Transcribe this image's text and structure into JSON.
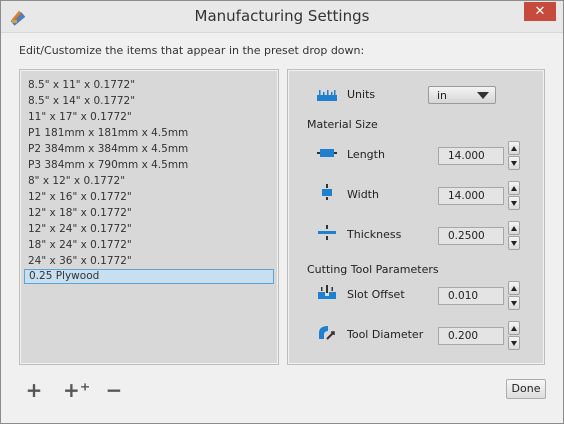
{
  "window": {
    "title": "Manufacturing Settings",
    "close_label": "✕",
    "app_icon": "pencil-ruler-icon"
  },
  "subtitle": "Edit/Customize the items that appear in the preset drop down:",
  "presets": [
    "8.5\" x 11\" x 0.1772\"",
    "8.5\" x 14\" x 0.1772\"",
    "11\" x 17\" x 0.1772\"",
    "P1 181mm x 181mm x 4.5mm",
    "P2 384mm x 384mm x 4.5mm",
    "P3 384mm x 790mm x 4.5mm",
    "8\" x 12\" x 0.1772\"",
    "12\" x 16\" x 0.1772\"",
    "12\" x 18\" x 0.1772\"",
    "12\" x 24\" x 0.1772\"",
    "18\" x 24\" x 0.1772\"",
    "24\" x 36\" x 0.1772\"",
    "0.25 Plywood"
  ],
  "selected_preset": "0.25 Plywood",
  "settings": {
    "units_label": "Units",
    "units_value": "in",
    "material_size_label": "Material Size",
    "length_label": "Length",
    "length_value": "14.000",
    "width_label": "Width",
    "width_value": "14.000",
    "thickness_label": "Thickness",
    "thickness_value": "0.2500",
    "cutting_tool_label": "Cutting Tool Parameters",
    "slot_offset_label": "Slot Offset",
    "slot_offset_value": "0.010",
    "tool_diameter_label": "Tool Diameter",
    "tool_diameter_value": "0.200"
  },
  "buttons": {
    "add_label": "+",
    "add_multiple_label": "+⁺",
    "remove_label": "−",
    "done_label": "Done"
  },
  "colors": {
    "accent_blue": "#1f7fd0",
    "selection_fill": "#c7dff0",
    "selection_border": "#5fa4d6",
    "close_red": "#c74b3d"
  }
}
